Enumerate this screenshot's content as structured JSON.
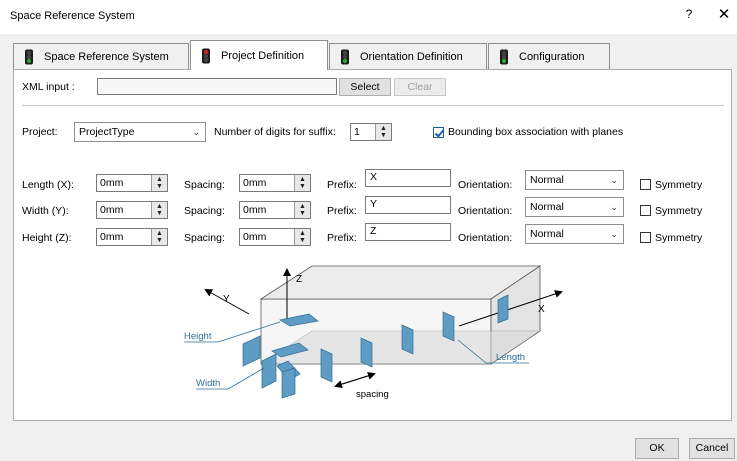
{
  "window": {
    "title": "Space Reference System",
    "help_label": "?",
    "close_label": "✕"
  },
  "tabs": [
    {
      "label": "Space Reference System",
      "icon": "traffic-light-green-icon",
      "active": false
    },
    {
      "label": "Project Definition",
      "icon": "traffic-light-red-icon",
      "active": true
    },
    {
      "label": "Orientation Definition",
      "icon": "traffic-light-green-icon",
      "active": false
    },
    {
      "label": "Configuration",
      "icon": "traffic-light-green-icon",
      "active": false
    }
  ],
  "xml": {
    "label": "XML input :",
    "value": "",
    "select_label": "Select",
    "clear_label": "Clear"
  },
  "project": {
    "label": "Project:",
    "value": "ProjectType",
    "digits_label": "Number of digits for suffix:",
    "digits_value": "1",
    "bbox_label": "Bounding box association with planes",
    "bbox_checked": true
  },
  "rows": [
    {
      "label": "Length (X):",
      "value": "0mm",
      "spacing_label": "Spacing:",
      "spacing_value": "0mm",
      "prefix_label": "Prefix:",
      "prefix_value": "X",
      "orientation_label": "Orientation:",
      "orientation_value": "Normal",
      "symmetry_label": "Symmetry",
      "symmetry_checked": false
    },
    {
      "label": "Width  (Y):",
      "value": "0mm",
      "spacing_label": "Spacing:",
      "spacing_value": "0mm",
      "prefix_label": "Prefix:",
      "prefix_value": "Y",
      "orientation_label": "Orientation:",
      "orientation_value": "Normal",
      "symmetry_label": "Symmetry",
      "symmetry_checked": false
    },
    {
      "label": "Height (Z):",
      "value": "0mm",
      "spacing_label": "Spacing:",
      "spacing_value": "0mm",
      "prefix_label": "Prefix:",
      "prefix_value": "Z",
      "orientation_label": "Orientation:",
      "orientation_value": "Normal",
      "symmetry_label": "Symmetry",
      "symmetry_checked": false
    }
  ],
  "diagram": {
    "axis_x": "X",
    "axis_y": "Y",
    "axis_z": "Z",
    "height_label": "Height",
    "width_label": "Width",
    "length_label": "Length",
    "spacing_label": "spacing"
  },
  "footer": {
    "ok_label": "OK",
    "cancel_label": "Cancel"
  },
  "colors": {
    "accent_blue": "#2e6e97",
    "plane_blue": "#5e9cc3",
    "green_light": "#2aa32a",
    "red_light": "#d42020"
  }
}
